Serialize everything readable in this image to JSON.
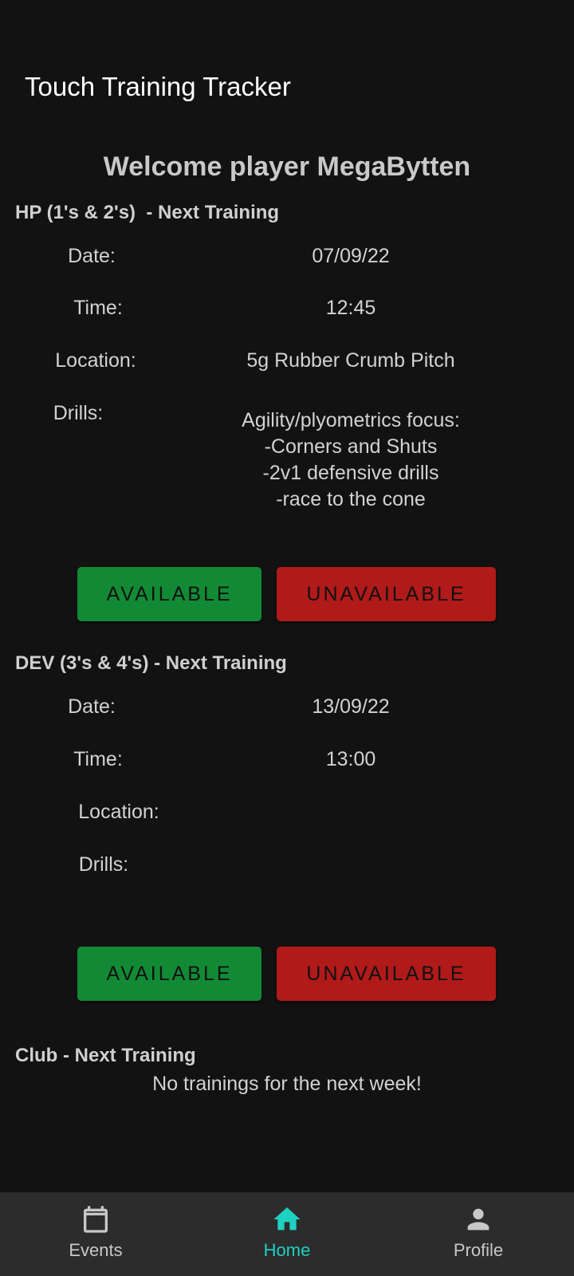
{
  "app": {
    "title": "Touch Training Tracker"
  },
  "welcome": "Welcome player MegaBytten",
  "labels": {
    "date": "Date:",
    "time": "Time:",
    "location": "Location:",
    "drills": "Drills:",
    "available": "AVAILABLE",
    "unavailable": "UNAVAILABLE"
  },
  "sections": [
    {
      "header": "HP (1's & 2's)  - Next Training",
      "date": "07/09/22",
      "time": "12:45",
      "location": "5g Rubber Crumb Pitch",
      "drills": [
        "Agility/plyometrics focus:",
        "-Corners and Shuts",
        "-2v1 defensive drills",
        "-race to the cone"
      ]
    },
    {
      "header": "DEV (3's & 4's) - Next Training",
      "date": "13/09/22",
      "time": "13:00",
      "location": "",
      "drills": []
    },
    {
      "header": "Club - Next Training",
      "message": "No trainings for the next week!"
    }
  ],
  "nav": {
    "items": [
      {
        "label": "Events",
        "icon": "calendar-icon",
        "active": false
      },
      {
        "label": "Home",
        "icon": "home-icon",
        "active": true
      },
      {
        "label": "Profile",
        "icon": "person-icon",
        "active": false
      }
    ],
    "active_color": "#1ed1c1",
    "inactive_color": "#c8c8c8"
  },
  "colors": {
    "available": "#128a35",
    "unavailable": "#b01a19",
    "background": "#121212"
  }
}
